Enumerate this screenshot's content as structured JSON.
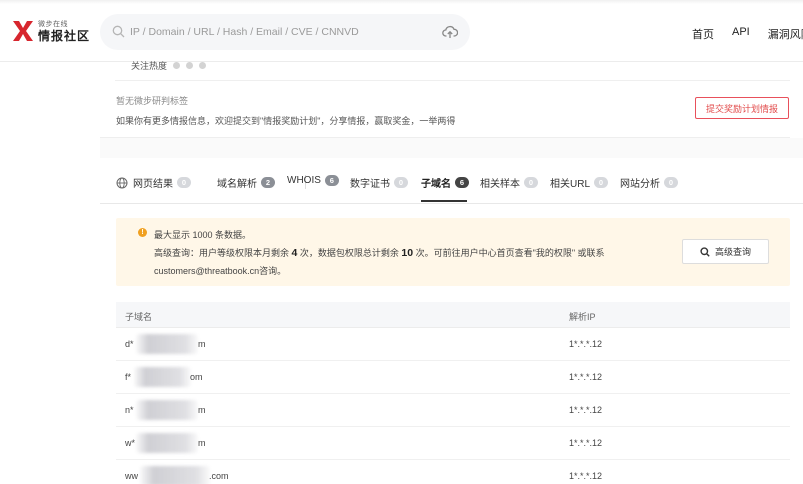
{
  "header": {
    "logo_sub": "微步在线",
    "logo_main": "情报社区",
    "search_placeholder": "IP / Domain / URL / Hash / Email / CVE / CNNVD",
    "nav": [
      "首页",
      "API",
      "漏洞风险"
    ]
  },
  "info": {
    "attention_label": "关注热度",
    "no_tags": "暂无微步研判标签",
    "tip": "如果你有更多情报信息，欢迎提交到\"情报奖励计划\"，分享情报，赢取奖金，一举两得",
    "submit_button": "提交奖励计划情报"
  },
  "tabs": [
    {
      "label": "网页结果",
      "count": "0",
      "active": false
    },
    {
      "label": "域名解析",
      "count": "2",
      "active": false
    },
    {
      "label": "WHOIS",
      "count": "6",
      "active": false
    },
    {
      "label": "数字证书",
      "count": "0",
      "active": false
    },
    {
      "label": "子域名",
      "count": "6",
      "active": true
    },
    {
      "label": "相关样本",
      "count": "0",
      "active": false
    },
    {
      "label": "相关URL",
      "count": "0",
      "active": false
    },
    {
      "label": "网站分析",
      "count": "0",
      "active": false
    }
  ],
  "notice": {
    "line1": "最大显示 1000 条数据。",
    "line2_a": "高级查询：用户等级权限本月剩余",
    "line2_n1": "4",
    "line2_b": "次，数据包权限总计剩余",
    "line2_n2": "10",
    "line2_c": "次。可前往用户中心首页查看\"我的权限\" 或联系",
    "line3": "customers@threatbook.cn咨询。",
    "button": "高级查询"
  },
  "table": {
    "headers": [
      "子域名",
      "解析IP"
    ],
    "rows": [
      {
        "prefix": "d*",
        "suffix": "m",
        "ip": "1*.*.*.12"
      },
      {
        "prefix": "f*",
        "suffix": "om",
        "ip": "1*.*.*.12"
      },
      {
        "prefix": "n*",
        "suffix": "m",
        "ip": "1*.*.*.12"
      },
      {
        "prefix": "w*",
        "suffix": "m",
        "ip": "1*.*.*.12"
      },
      {
        "prefix": "ww",
        "suffix": ".com",
        "ip": "1*.*.*.12"
      }
    ]
  },
  "colors": {
    "accent_red": "#e24b4b",
    "notice_bg": "#fff7e8",
    "warn": "#f0a020"
  }
}
